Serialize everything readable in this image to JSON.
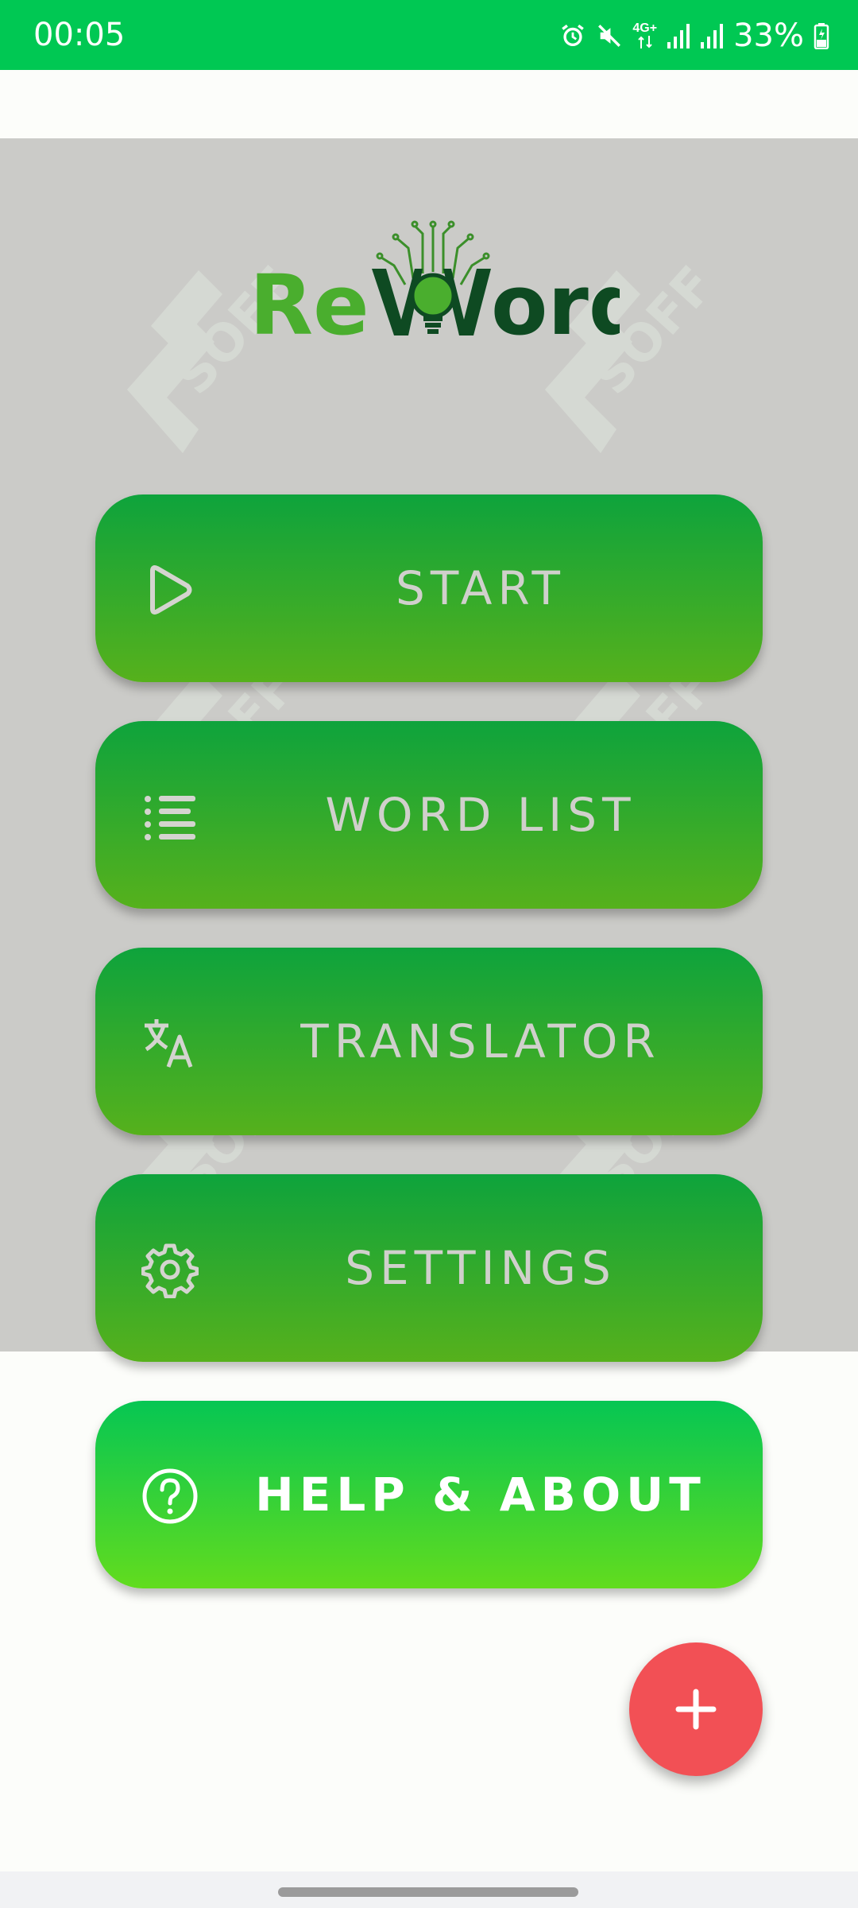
{
  "status_bar": {
    "time": "00:05",
    "network": "4G+",
    "battery": "33%",
    "icons": [
      "alarm-icon",
      "mute-icon",
      "network-icon",
      "signal-icon",
      "signal-icon",
      "battery-icon"
    ]
  },
  "app": {
    "logo_text": "ReWord",
    "watermark_text": "SOFF"
  },
  "menu": {
    "start": {
      "label": "START",
      "icon": "play-icon"
    },
    "word_list": {
      "label": "WORD LIST",
      "icon": "list-icon"
    },
    "translator": {
      "label": "TRANSLATOR",
      "icon": "translate-icon"
    },
    "settings": {
      "label": "SETTINGS",
      "icon": "gear-icon"
    },
    "help": {
      "label": "HELP & ABOUT",
      "icon": "help-icon"
    }
  },
  "fab": {
    "icon": "plus-icon"
  },
  "colors": {
    "status_bar": "#00c853",
    "button_top": "#0ea33c",
    "button_bottom": "#56b11c",
    "help_top": "#06c653",
    "help_bottom": "#62dc1e",
    "fab": "#f25055",
    "overlay": "#cbcbc8"
  }
}
